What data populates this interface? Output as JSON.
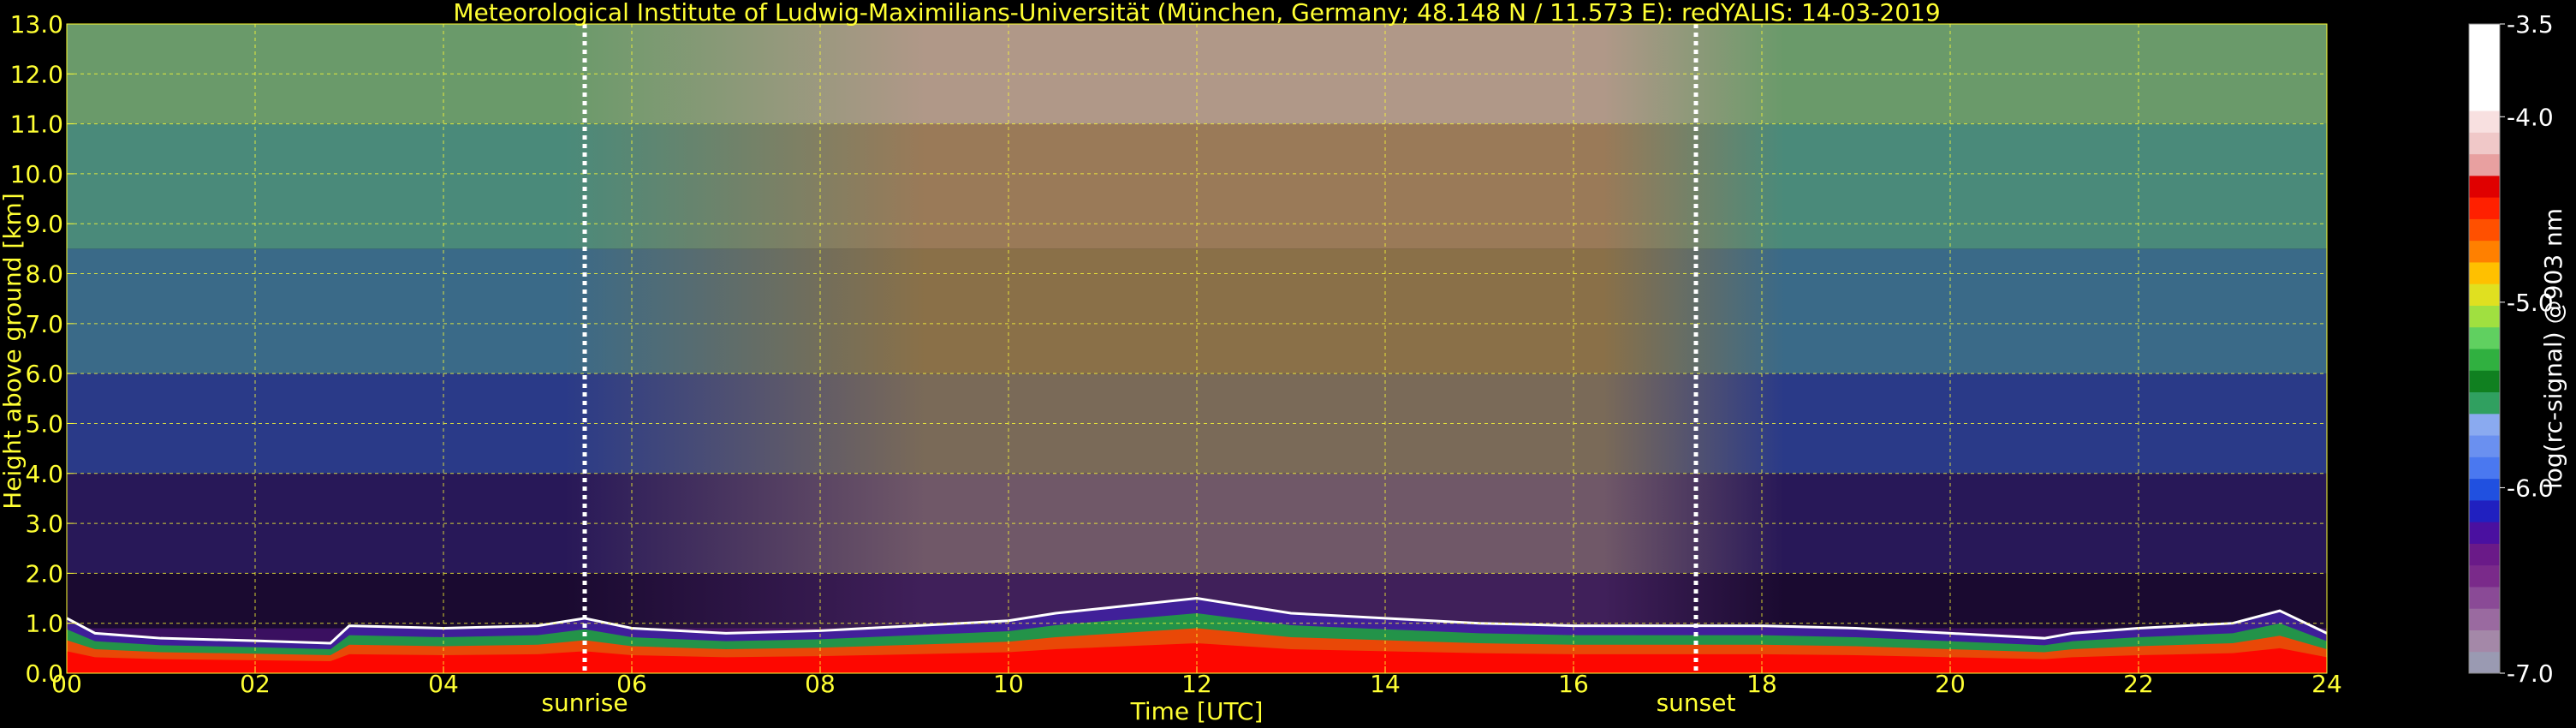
{
  "colors": {
    "background": "#000000",
    "label_text": "#ffff33",
    "grid": "#ffff33",
    "colorbar_text": "#ffffff",
    "sun_lines": "#ffffff"
  },
  "chart_data": {
    "type": "heatmap",
    "title": "Meteorological Institute of Ludwig-Maximilians-Universität (München, Germany; 48.148 N / 11.573 E):    redYALIS: 14-03-2019",
    "xlabel": "Time [UTC]",
    "ylabel": "Height above ground [km]",
    "xlim": [
      0,
      24
    ],
    "ylim": [
      0,
      13
    ],
    "x_ticks": [
      0,
      2,
      4,
      6,
      8,
      10,
      12,
      14,
      16,
      18,
      20,
      22,
      24
    ],
    "x_tick_labels": [
      "00",
      "02",
      "04",
      "06",
      "08",
      "10",
      "12",
      "14",
      "16",
      "18",
      "20",
      "22",
      "24"
    ],
    "y_ticks": [
      0,
      1,
      2,
      3,
      4,
      5,
      6,
      7,
      8,
      9,
      10,
      11,
      12,
      13
    ],
    "y_tick_labels": [
      "0.0",
      "1.0",
      "2.0",
      "3.0",
      "4.0",
      "5.0",
      "6.0",
      "7.0",
      "8.0",
      "9.0",
      "10.0",
      "11.0",
      "12.0",
      "13.0"
    ],
    "grid": true,
    "markers": [
      {
        "name": "sunrise",
        "x": 5.5
      },
      {
        "name": "sunset",
        "x": 17.3
      }
    ],
    "colorbar": {
      "label": "log(rc-signal) @903 nm",
      "range": [
        -7.0,
        -3.5
      ],
      "tick_values": [
        -7.0,
        -6.0,
        -5.0,
        -4.0,
        -3.5
      ],
      "tick_labels": [
        "-7.0",
        "-6.0",
        "-5.0",
        "-4.0",
        "-3.5"
      ],
      "colors": [
        "#9a9ab2",
        "#a488a8",
        "#9a6aa0",
        "#8a4a96",
        "#7a2a8a",
        "#6a1a88",
        "#4a10a0",
        "#2020c0",
        "#2050e0",
        "#4a78f0",
        "#6a90f0",
        "#8aaaf0",
        "#30a060",
        "#108020",
        "#30b040",
        "#60d060",
        "#a0e040",
        "#e0e020",
        "#ffc000",
        "#ff8000",
        "#ff5000",
        "#ff2000",
        "#e00000",
        "#e8a0a0",
        "#f0c8c8",
        "#f8e0e0",
        "#ffffff",
        "#ffffff",
        "#ffffff",
        "#ffffff"
      ]
    },
    "boundary_layer_top_km": {
      "x": [
        0,
        0.3,
        1,
        2,
        2.8,
        3,
        4,
        5,
        5.5,
        6,
        7,
        8,
        9,
        10,
        10.5,
        11,
        12,
        13,
        14,
        15,
        16,
        17,
        18,
        19,
        20,
        21,
        21.3,
        22,
        23,
        23.5,
        24
      ],
      "values": [
        1.1,
        0.8,
        0.7,
        0.65,
        0.6,
        0.95,
        0.9,
        0.95,
        1.1,
        0.9,
        0.8,
        0.85,
        0.95,
        1.05,
        1.2,
        1.3,
        1.5,
        1.2,
        1.1,
        1.0,
        0.95,
        0.95,
        0.95,
        0.9,
        0.8,
        0.7,
        0.8,
        0.9,
        1.0,
        1.25,
        0.8
      ]
    }
  }
}
